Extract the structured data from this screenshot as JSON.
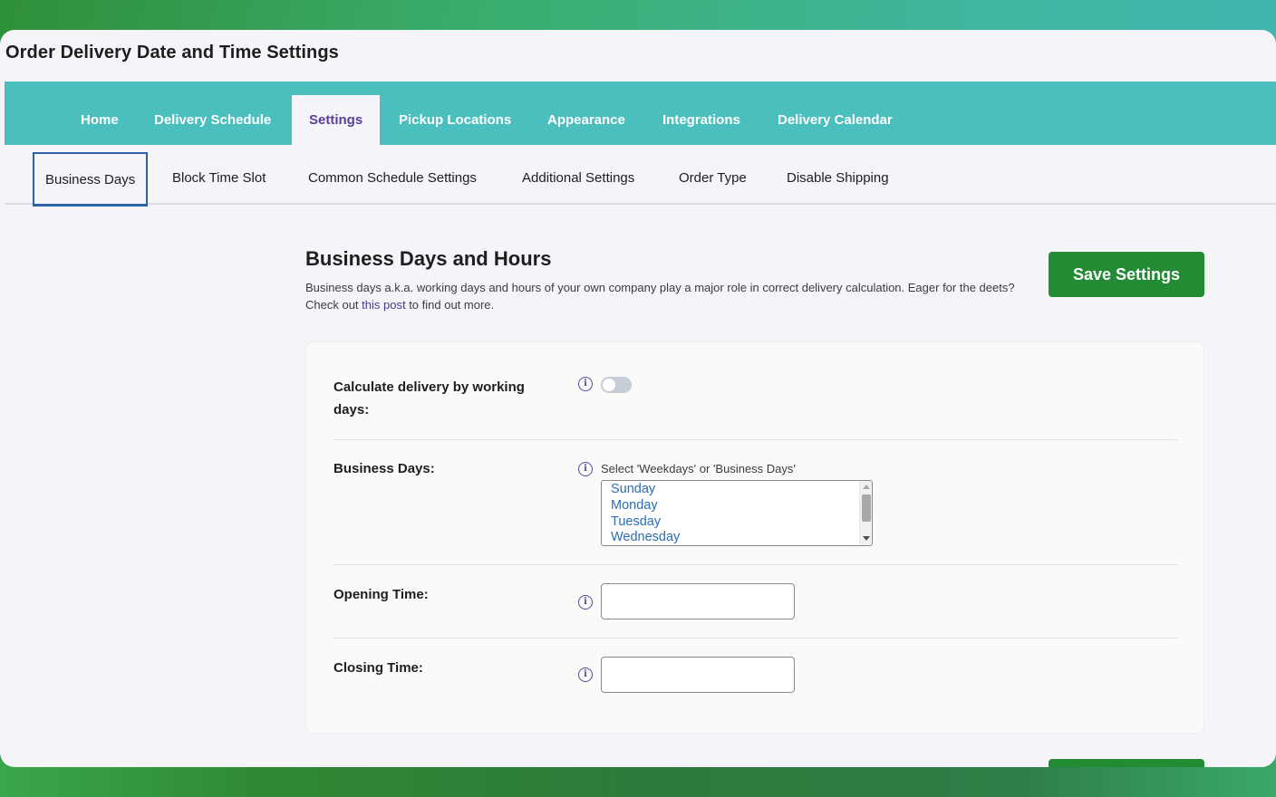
{
  "page": {
    "title": "Order Delivery Date and Time Settings"
  },
  "main_nav": {
    "tabs": [
      {
        "label": "Home"
      },
      {
        "label": "Delivery Schedule"
      },
      {
        "label": "Settings",
        "active": true
      },
      {
        "label": "Pickup Locations"
      },
      {
        "label": "Appearance"
      },
      {
        "label": "Integrations"
      },
      {
        "label": "Delivery Calendar"
      }
    ]
  },
  "sub_nav": {
    "tabs": [
      {
        "label": "Business Days",
        "active": true
      },
      {
        "label": "Block Time Slot"
      },
      {
        "label": "Common Schedule Settings"
      },
      {
        "label": "Additional Settings"
      },
      {
        "label": "Order Type"
      },
      {
        "label": "Disable Shipping"
      }
    ]
  },
  "section": {
    "title": "Business Days and Hours",
    "desc_before": "Business days a.k.a. working days and hours of your own company play a major role in correct delivery calculation. Eager for the deets? Check out ",
    "desc_link": "this post",
    "desc_after": " to find out more.",
    "save_label": "Save Settings"
  },
  "form": {
    "calc_working_days": {
      "label": "Calculate delivery by working days:",
      "info_icon": "info-icon",
      "enabled": false
    },
    "business_days": {
      "label": "Business Days:",
      "hint": "Select 'Weekdays' or 'Business Days'",
      "visible_options": [
        "Sunday",
        "Monday",
        "Tuesday",
        "Wednesday"
      ]
    },
    "opening_time": {
      "label": "Opening Time:",
      "value": ""
    },
    "closing_time": {
      "label": "Closing Time:",
      "value": ""
    }
  },
  "colors": {
    "nav_bg": "#4bbfbe",
    "active_tab_text": "#5b3f9a",
    "save_button": "#228b34",
    "option_text": "#2c6db5",
    "subtab_border": "#2f5fa8"
  }
}
